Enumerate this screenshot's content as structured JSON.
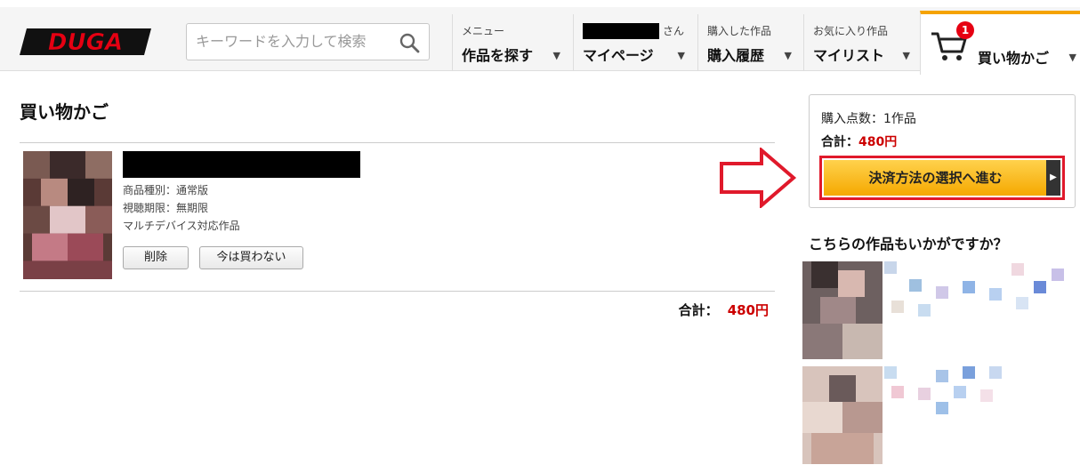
{
  "header": {
    "logo_text": "DUGA",
    "search_placeholder": "キーワードを入力して検索",
    "menu_small": "メニュー",
    "menu_big": "作品を探す",
    "user_suffix": "さん",
    "mypage_big": "マイページ",
    "history_small": "購入した作品",
    "history_big": "購入履歴",
    "fav_small": "お気に入り作品",
    "fav_big": "マイリスト",
    "cart_badge": "1",
    "cart_big": "買い物かご",
    "caret": "▼"
  },
  "main": {
    "title": "買い物かご",
    "item": {
      "type": "商品種別：通常版",
      "period": "視聴期限：無期限",
      "device": "マルチデバイス対応作品",
      "delete_label": "削除",
      "later_label": "今は買わない"
    },
    "total_label": "合計：",
    "total_amount": "480円"
  },
  "sidebar": {
    "count_text": "購入点数：1作品",
    "sum_label": "合計：",
    "sum_amount": "480円",
    "proceed_label": "決済方法の選択へ進む",
    "proceed_tab": "▶",
    "rec_title": "こちらの作品もいかがですか？"
  },
  "colors": {
    "accent": "#f5a300",
    "price": "#cc0000",
    "highlight_border": "#e0192b"
  }
}
